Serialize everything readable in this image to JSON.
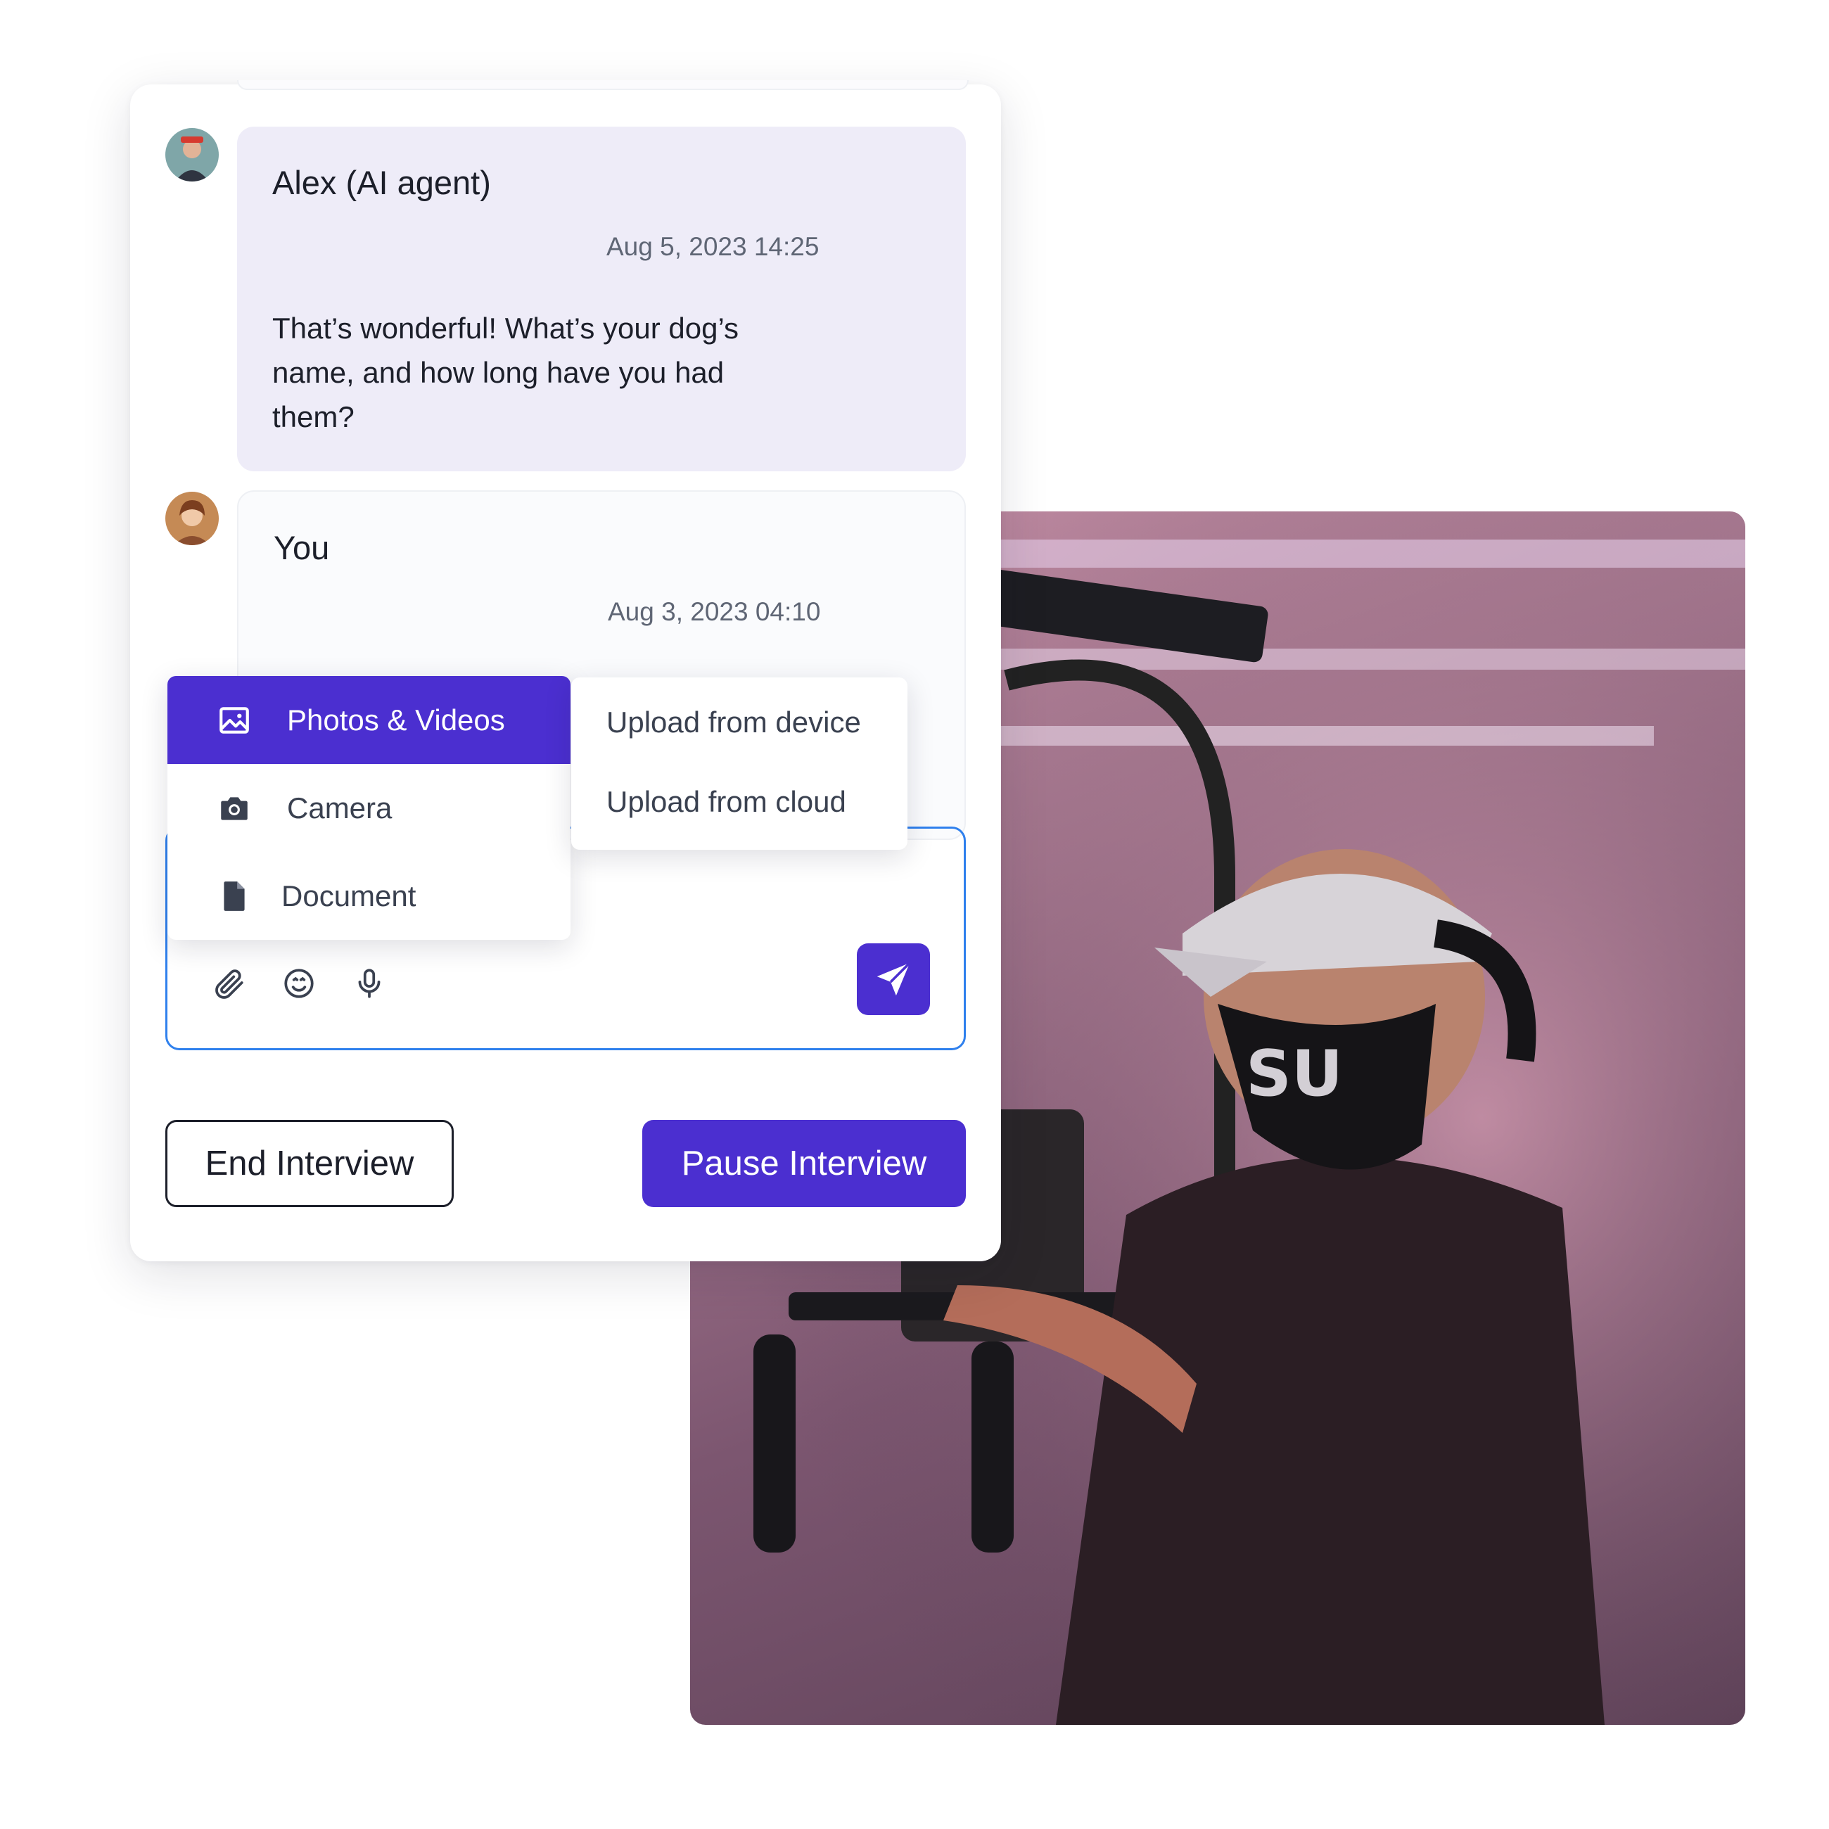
{
  "chat": {
    "messages": [
      {
        "sender": "Alex (AI agent)",
        "timestamp": "Aug 5, 2023 14:25",
        "text": "That’s wonderful! What’s your dog’s name, and how long have you had them?"
      },
      {
        "sender": "You",
        "timestamp": "Aug 3, 2023 04:10"
      }
    ]
  },
  "attach_menu": {
    "items": [
      {
        "label": "Photos & Videos",
        "icon": "image-icon",
        "active": true
      },
      {
        "label": "Camera",
        "icon": "camera-icon",
        "active": false
      },
      {
        "label": "Document",
        "icon": "document-icon",
        "active": false
      }
    ],
    "submenu": [
      {
        "label": "Upload from device"
      },
      {
        "label": "Upload from cloud"
      }
    ]
  },
  "composer": {
    "tools": [
      "paperclip-icon",
      "emoji-icon",
      "microphone-icon"
    ],
    "send_icon": "send-icon"
  },
  "actions": {
    "end_label": "End Interview",
    "pause_label": "Pause Interview"
  },
  "colors": {
    "accent": "#4b2fd0",
    "agent_bubble": "#eeecf8",
    "composer_border": "#2f80ed"
  }
}
